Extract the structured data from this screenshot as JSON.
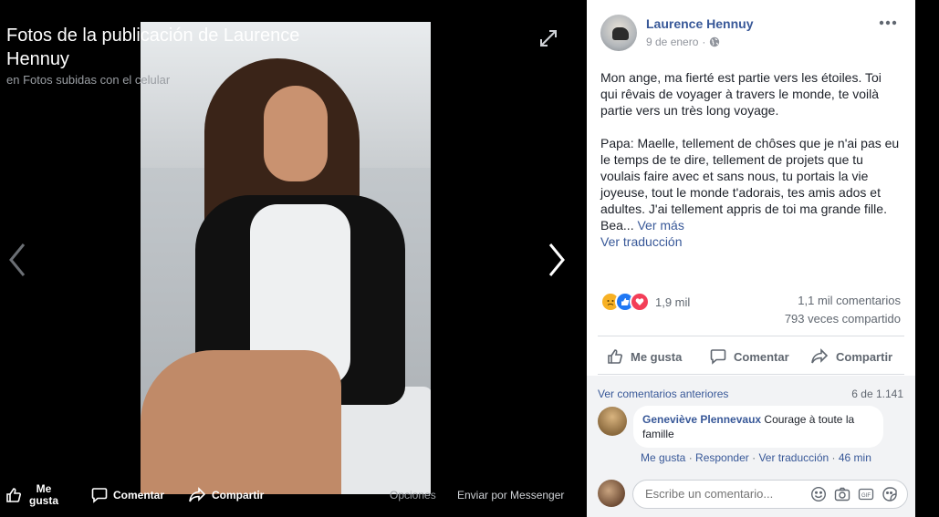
{
  "viewer": {
    "title": "Fotos de la publicación de Laurence Hennuy",
    "subtitle": "en Fotos subidas con el celular",
    "bottom_bar": {
      "like_line1": "Me",
      "like_line2": "gusta",
      "comment": "Comentar",
      "share": "Compartir",
      "options": "Opciones",
      "messenger": "Enviar por Messenger"
    }
  },
  "post": {
    "author": "Laurence Hennuy",
    "date": "9 de enero",
    "date_sep": "·",
    "paragraph1": "Mon ange, ma fierté est partie vers les étoiles. Toi qui rêvais de voyager à travers le monde, te voilà partie vers un très long voyage.",
    "paragraph2": "Papa: Maelle, tellement de chôses que je n'ai pas eu le temps de te dire, tellement de projets que tu voulais faire avec et sans nous, tu portais la vie joyeuse, tout le monde t'adorais, tes amis ados et adultes. J'ai tellement appris de toi ma grande fille. Bea...",
    "see_more": "Ver más",
    "translate": "Ver traducción",
    "reactions_count": "1,9 mil",
    "comments_count": "1,1 mil comentarios",
    "shares_count": "793 veces compartido"
  },
  "actions": {
    "like": "Me gusta",
    "comment": "Comentar",
    "share": "Compartir"
  },
  "comments": {
    "previous_link": "Ver comentarios anteriores",
    "position": "6 de 1.141",
    "items": [
      {
        "name": "Geneviève Plennevaux",
        "text": "Courage à toute la famille",
        "like": "Me gusta",
        "reply": "Responder",
        "translate": "Ver traducción",
        "time": "46 min",
        "sep": "·"
      }
    ],
    "input_placeholder": "Escribe un comentario..."
  },
  "colors": {
    "link": "#385898",
    "like_blue": "#2078f4",
    "love_red": "#f33e58",
    "sad_yellow": "#f7b125"
  }
}
